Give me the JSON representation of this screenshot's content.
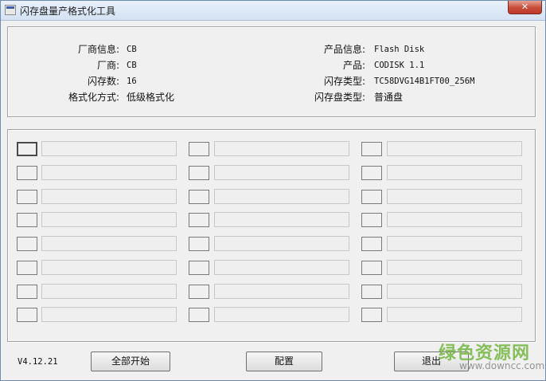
{
  "window": {
    "title": "闪存盘量产格式化工具",
    "close_glyph": "✕"
  },
  "info": {
    "vendor_info_label": "厂商信息:",
    "vendor_info_value": "CB",
    "vendor_label": "厂商:",
    "vendor_value": "CB",
    "flash_count_label": "闪存数:",
    "flash_count_value": "16",
    "format_mode_label": "格式化方式:",
    "format_mode_value": "低级格式化",
    "product_info_label": "产品信息:",
    "product_info_value": "Flash Disk",
    "product_label": "产品:",
    "product_value": "CODISK 1.1",
    "flash_type_label": "闪存类型:",
    "flash_type_value": "TC58DVG14B1FT00_256M",
    "disk_type_label": "闪存盘类型:",
    "disk_type_value": "普通盘"
  },
  "ports": {
    "columns": 3,
    "rows": 8
  },
  "footer": {
    "version": "V4.12.21",
    "start_all_label": "全部开始",
    "config_label": "配置",
    "exit_label": "退出"
  },
  "watermark": {
    "text": "绿色资源网",
    "url": "www.downcc.com"
  },
  "colors": {
    "window_bg": "#f0f0f0",
    "close_button": "#c74c37",
    "watermark_green": "#7ab94a"
  },
  "icons": {
    "app": "app-window-icon",
    "close": "close-icon"
  }
}
